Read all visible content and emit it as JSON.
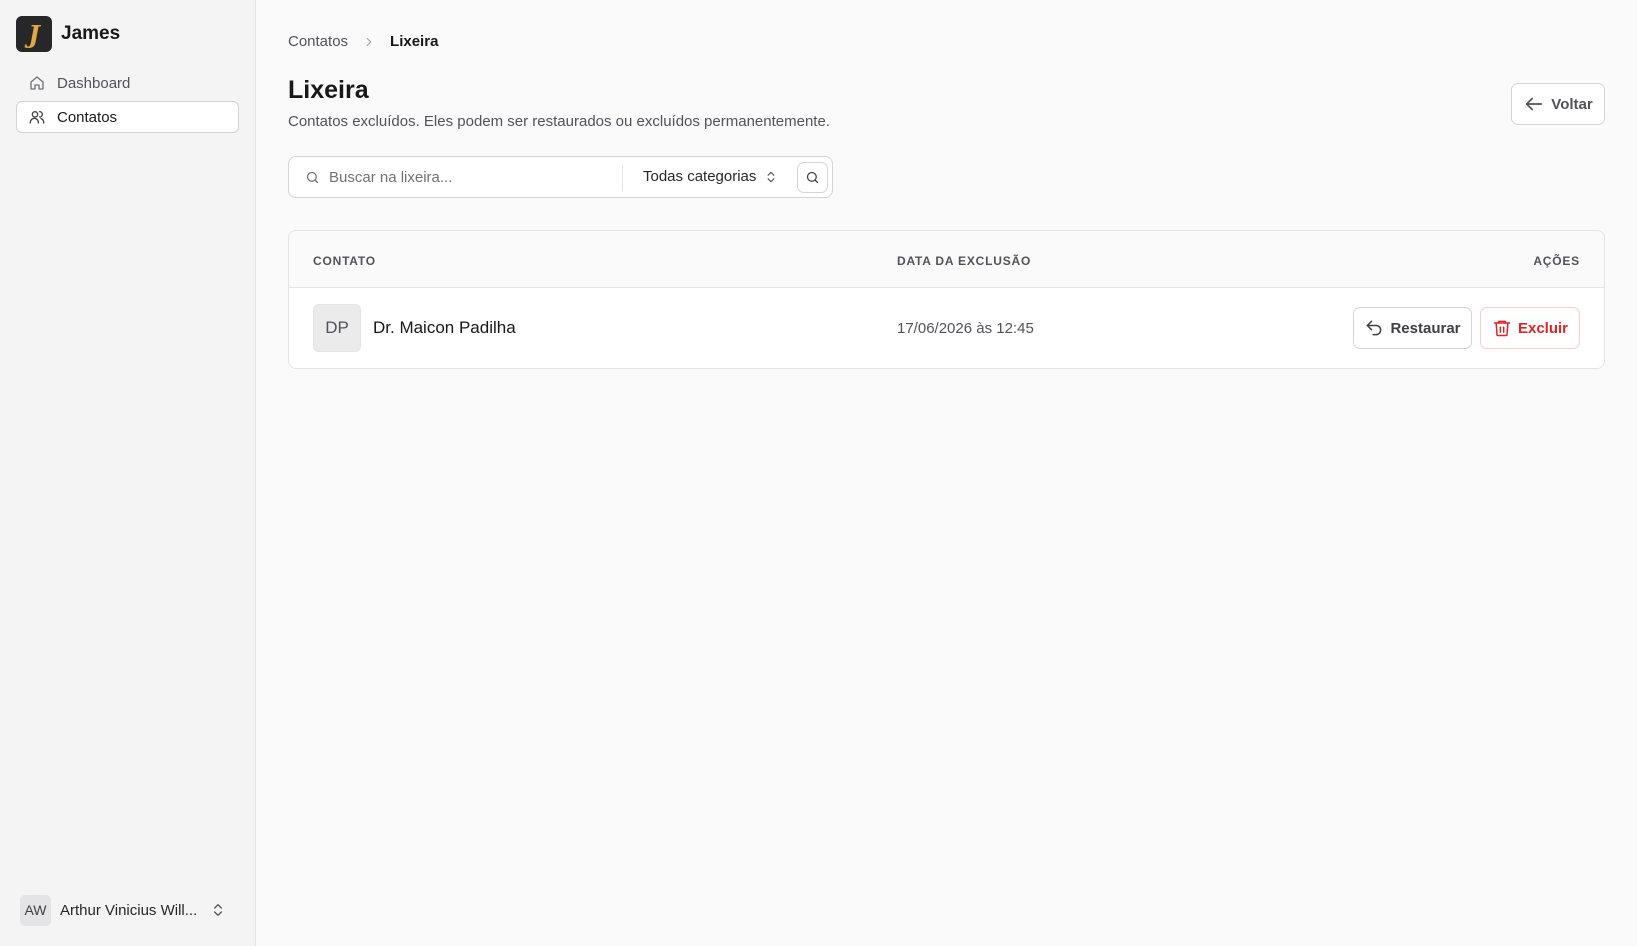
{
  "brand": {
    "logo_letter": "J",
    "name": "James"
  },
  "sidebar": {
    "items": [
      {
        "label": "Dashboard",
        "icon": "home-icon",
        "active": false
      },
      {
        "label": "Contatos",
        "icon": "users-icon",
        "active": true
      }
    ]
  },
  "user": {
    "initials": "AW",
    "name": "Arthur Vinicius Will..."
  },
  "breadcrumb": {
    "parent": "Contatos",
    "current": "Lixeira"
  },
  "page": {
    "title": "Lixeira",
    "subtitle": "Contatos excluídos. Eles podem ser restaurados ou excluídos permanentemente."
  },
  "actions": {
    "back_label": "Voltar"
  },
  "search": {
    "placeholder": "Buscar na lixeira...",
    "value": "",
    "category": "Todas categorias"
  },
  "table": {
    "headers": {
      "contact": "CONTATO",
      "date": "DATA DA EXCLUSÃO",
      "actions": "AÇÕES"
    },
    "rows": [
      {
        "initials": "DP",
        "name": "Dr. Maicon Padilha",
        "deleted_at": "17/06/2026 às 12:45",
        "restore_label": "Restaurar",
        "delete_label": "Excluir"
      }
    ]
  },
  "colors": {
    "danger": "#dc2626",
    "logo_bg": "#27272a",
    "logo_fg": "#e4a93a"
  }
}
